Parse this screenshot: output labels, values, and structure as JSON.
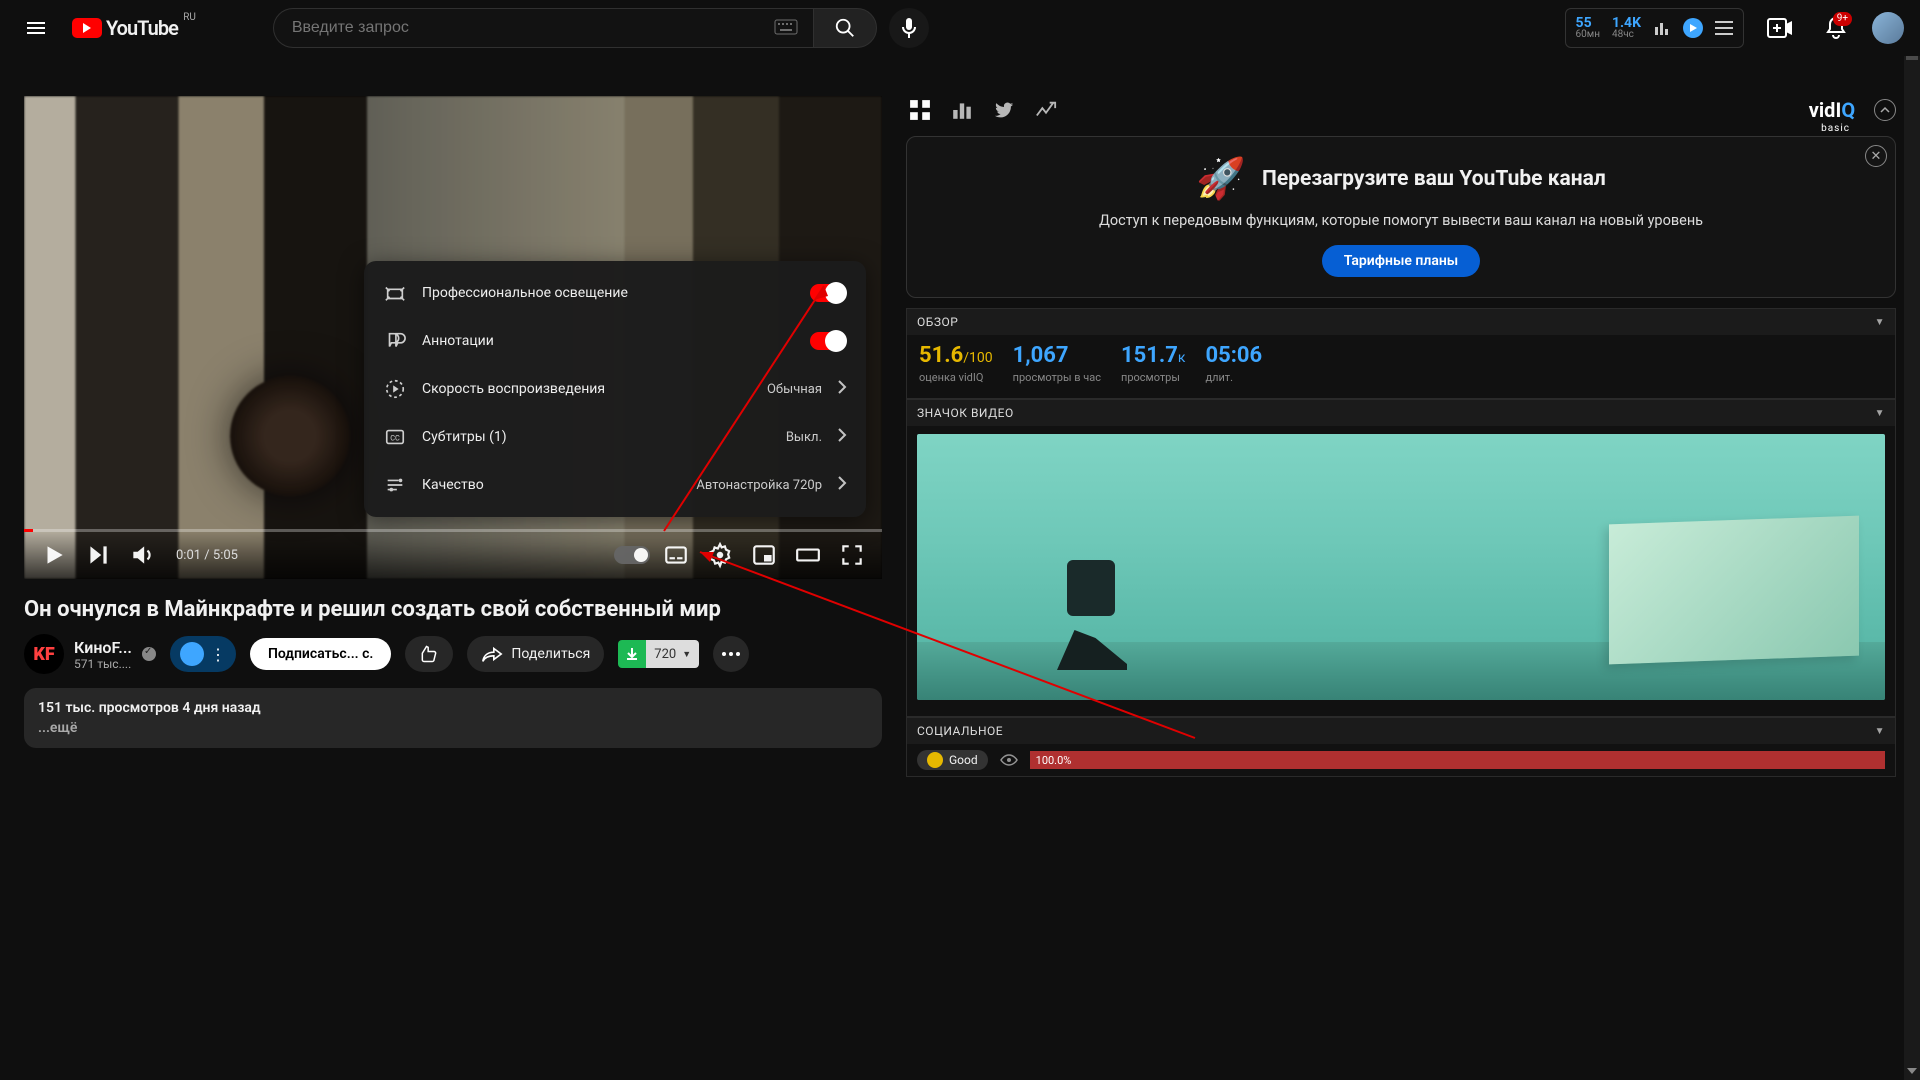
{
  "topbar": {
    "country": "RU",
    "brand": "YouTube",
    "search_placeholder": "Введите запрос",
    "vidiq_stats": {
      "n1": "55",
      "n1_sub": "60мн",
      "n2": "1.4K",
      "n2_sub": "48чс"
    },
    "notifications": "9+"
  },
  "player": {
    "time_current": "0:01",
    "time_total": "5:05"
  },
  "settings_menu": {
    "rows": [
      {
        "icon": "lighting",
        "label": "Профессиональное освещение",
        "type": "toggle",
        "on": true
      },
      {
        "icon": "annotations",
        "label": "Аннотации",
        "type": "toggle",
        "on": true
      },
      {
        "icon": "speed",
        "label": "Скорость воспроизведения",
        "type": "link",
        "value": "Обычная"
      },
      {
        "icon": "cc",
        "label": "Субтитры (1)",
        "type": "link",
        "value": "Выкл."
      },
      {
        "icon": "quality",
        "label": "Качество",
        "type": "link",
        "value": "Автонастройка 720p"
      }
    ]
  },
  "video": {
    "title": "Он очнулся в Майнкрафте и решил создать свой собственный мир",
    "channel_name": "КиноF...",
    "channel_initials": "KF",
    "subs": "571 тыс....",
    "subscribe_label": "Подписатьс...    с.",
    "share_label": "Поделиться",
    "download_quality": "720",
    "meta": "151 тыс. просмотров  4 дня назад",
    "expand": "...ещё"
  },
  "sidebar": {
    "promo": {
      "title": "Перезагрузите ваш YouTube канал",
      "body": "Доступ к передовым функциям, которые помогут вывести ваш канал на новый уровень",
      "cta": "Тарифные планы"
    },
    "overview_header": "ОБЗОР",
    "overview": [
      {
        "value": "51.6",
        "suffix": "/100",
        "label": "оценка vidIQ"
      },
      {
        "value": "1,067",
        "suffix": "",
        "label": "просмотры в час"
      },
      {
        "value": "151.7",
        "suffix": "к",
        "label": "просмотры"
      },
      {
        "value": "05:06",
        "suffix": "",
        "label": "длит."
      }
    ],
    "thumb_header": "ЗНАЧОК ВИДЕО",
    "social_header": "СОЦИАЛЬНОЕ",
    "social": {
      "good": "Good",
      "pct": "100.0%"
    }
  }
}
